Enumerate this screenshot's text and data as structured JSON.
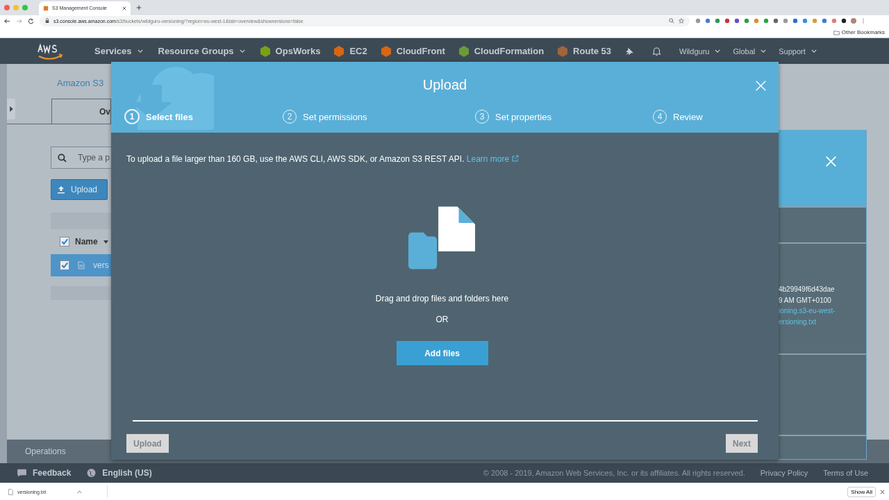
{
  "browser": {
    "tab_title": "S3 Management Console",
    "url_host": "s3.console.aws.amazon.com",
    "url_path": "/s3/buckets/wildguru-versioning/?region=eu-west-1&tab=overview&showversions=false",
    "bookmarks": "Other Bookmarks"
  },
  "navbar": {
    "menus": [
      {
        "label": "Services"
      },
      {
        "label": "Resource Groups"
      }
    ],
    "services": [
      {
        "label": "OpsWorks",
        "color": "#7aa116"
      },
      {
        "label": "EC2",
        "color": "#d86613"
      },
      {
        "label": "CloudFront",
        "color": "#d86613"
      },
      {
        "label": "CloudFormation",
        "color": "#6b9a3a"
      },
      {
        "label": "Route 53",
        "color": "#a0653a"
      }
    ],
    "right_menus": [
      {
        "label": "Wildguru"
      },
      {
        "label": "Global"
      },
      {
        "label": "Support"
      }
    ]
  },
  "page": {
    "breadcrumb": "Amazon S3",
    "tab": "Ov",
    "search_placeholder": "Type a p",
    "upload_button": "Upload",
    "header_checked": true,
    "column_header": "Name",
    "rows": [
      {
        "name": "vers",
        "checked": true,
        "selected": true
      }
    ],
    "operations": "Operations"
  },
  "side_panel": {
    "lines": [
      {
        "text": "4b29949f6d43dae",
        "kind": "text"
      },
      {
        "text": "9 AM GMT+0100",
        "kind": "text"
      },
      {
        "text": "ioning.s3-eu-west-",
        "kind": "link"
      },
      {
        "text": "ersioning.txt",
        "kind": "link"
      }
    ]
  },
  "modal": {
    "title": "Upload",
    "steps": [
      {
        "number": "1",
        "label": "Select files",
        "selected": true
      },
      {
        "number": "2",
        "label": "Set permissions",
        "selected": false
      },
      {
        "number": "3",
        "label": "Set properties",
        "selected": false
      },
      {
        "number": "4",
        "label": "Review",
        "selected": false
      }
    ],
    "notice": "To upload a file larger than 160 GB, use the AWS CLI, AWS SDK, or Amazon S3 REST API.",
    "learn_more": "Learn more",
    "drop_text": "Drag and drop files and folders here",
    "or_text": "OR",
    "add_files": "Add files",
    "upload_button": {
      "label": "Upload",
      "disabled": true
    },
    "next_button": {
      "label": "Next",
      "disabled": true
    }
  },
  "footer": {
    "feedback": "Feedback",
    "language": "English (US)",
    "copyright": "© 2008 - 2019, Amazon Web Services, Inc. or its affiliates. All rights reserved.",
    "links": [
      "Privacy Policy",
      "Terms of Use"
    ]
  },
  "downloads": {
    "file": "versioning.txt",
    "show_all": "Show All"
  }
}
